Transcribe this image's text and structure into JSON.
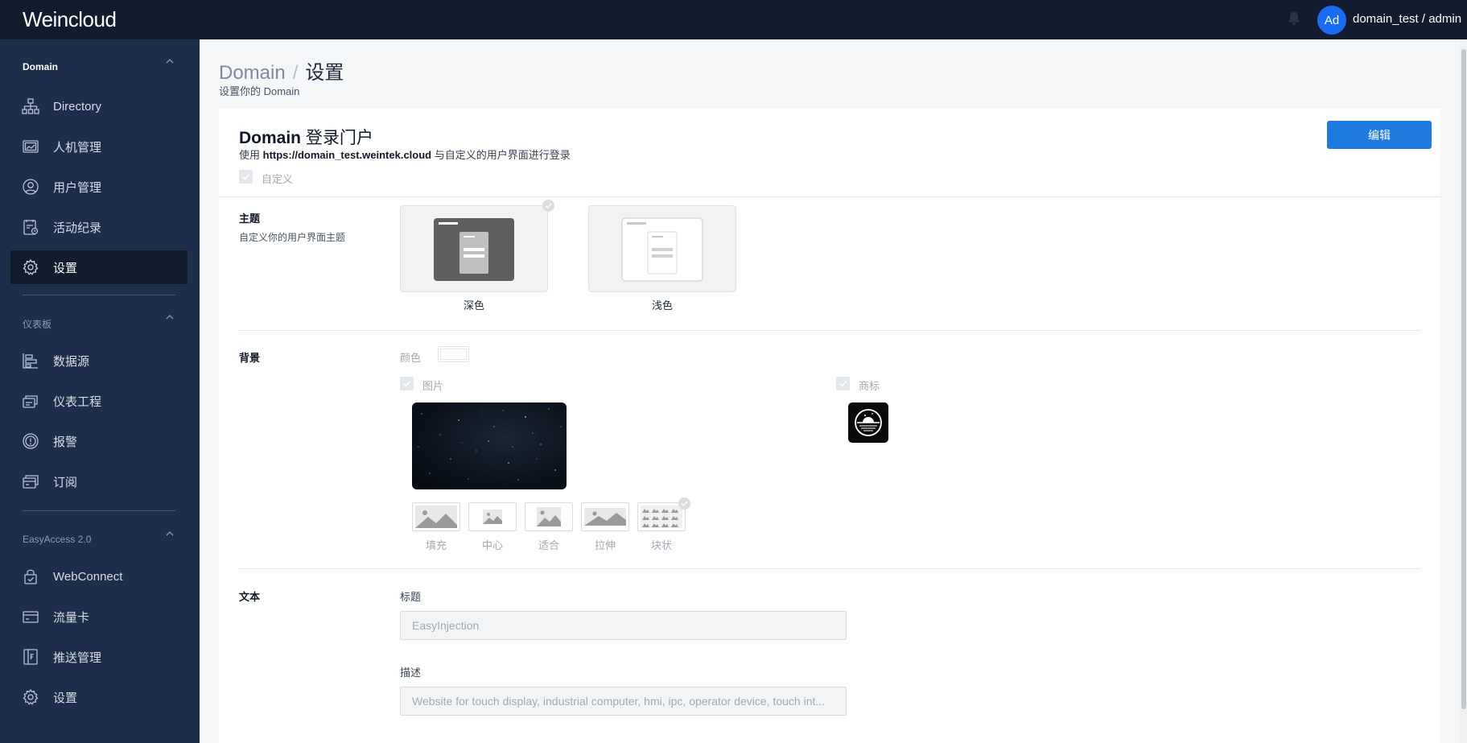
{
  "header": {
    "app_name": "Weincloud",
    "avatar_initials": "Ad",
    "user": "domain_test / admin"
  },
  "sidebar": {
    "sections": [
      {
        "title": "Domain",
        "items": [
          {
            "label": "Directory",
            "icon": "org-chart-icon"
          },
          {
            "label": "人机管理",
            "icon": "hmi-screen-icon"
          },
          {
            "label": "用户管理",
            "icon": "user-circle-icon"
          },
          {
            "label": "活动纪录",
            "icon": "activity-log-icon"
          },
          {
            "label": "设置",
            "icon": "gear-icon",
            "selected": true
          }
        ]
      },
      {
        "title": "仪表板",
        "items": [
          {
            "label": "数据源",
            "icon": "data-source-icon"
          },
          {
            "label": "仪表工程",
            "icon": "dashboard-project-icon"
          },
          {
            "label": "报警",
            "icon": "alarm-icon"
          },
          {
            "label": "订阅",
            "icon": "subscription-icon"
          }
        ]
      },
      {
        "title": "EasyAccess 2.0",
        "items": [
          {
            "label": "WebConnect",
            "icon": "lock-icon"
          },
          {
            "label": "流量卡",
            "icon": "card-icon"
          },
          {
            "label": "推送管理",
            "icon": "push-icon"
          },
          {
            "label": "设置",
            "icon": "gear-icon"
          }
        ]
      }
    ]
  },
  "page": {
    "breadcrumb_root": "Domain",
    "breadcrumb_sep": "/",
    "breadcrumb_current": "设置",
    "subtitle": "设置你的 Domain"
  },
  "portal": {
    "title_en": "Domain",
    "title_cn": "登录门户",
    "desc_prefix": "使用",
    "url": "https://domain_test.weintek.cloud",
    "desc_suffix": "与自定义的用户界面进行登录",
    "edit_label": "编辑",
    "custom_label": "自定义"
  },
  "theme": {
    "title": "主题",
    "desc": "自定义你的用户界面主题",
    "options": [
      {
        "label": "深色",
        "selected": true
      },
      {
        "label": "浅色",
        "selected": false
      }
    ]
  },
  "background": {
    "title": "背景",
    "color_label": "颜色",
    "color_value": "#ffffff",
    "image_label": "图片",
    "logo_label": "商标",
    "modes": [
      {
        "label": "填充"
      },
      {
        "label": "中心"
      },
      {
        "label": "适合"
      },
      {
        "label": "拉伸"
      },
      {
        "label": "块状",
        "selected": true
      }
    ]
  },
  "text": {
    "title": "文本",
    "heading_label": "标题",
    "heading_value": "EasyInjection",
    "desc_label": "描述",
    "desc_value": "Website for touch display, industrial computer, hmi, ipc, operator device, touch int..."
  },
  "colors": {
    "topbar": "#131c2f",
    "sidebar": "#1c2e4a",
    "accent": "#1f7ae0"
  }
}
